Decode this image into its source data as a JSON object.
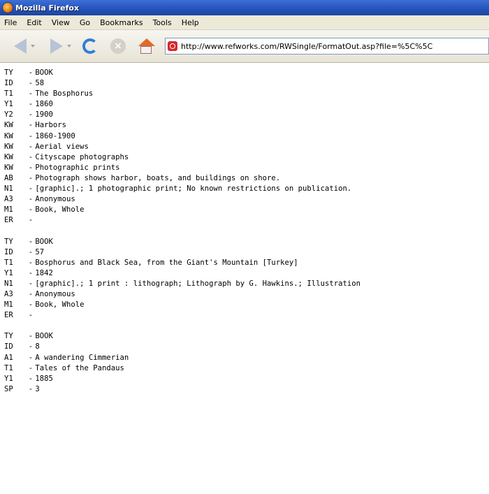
{
  "window": {
    "title": "Mozilla Firefox"
  },
  "menu": [
    "File",
    "Edit",
    "View",
    "Go",
    "Bookmarks",
    "Tools",
    "Help"
  ],
  "nav": {
    "url": "http://www.refworks.com/RWSingle/FormatOut.asp?file=%5C%5C"
  },
  "records": [
    [
      {
        "tag": "TY",
        "value": "BOOK"
      },
      {
        "tag": "ID",
        "value": "58"
      },
      {
        "tag": "T1",
        "value": "The Bosphorus"
      },
      {
        "tag": "Y1",
        "value": "1860"
      },
      {
        "tag": "Y2",
        "value": "1900"
      },
      {
        "tag": "KW",
        "value": "Harbors"
      },
      {
        "tag": "KW",
        "value": "1860-1900"
      },
      {
        "tag": "KW",
        "value": "Aerial views"
      },
      {
        "tag": "KW",
        "value": "Cityscape photographs"
      },
      {
        "tag": "KW",
        "value": "Photographic prints"
      },
      {
        "tag": "AB",
        "value": "Photograph shows harbor, boats, and buildings on shore."
      },
      {
        "tag": "N1",
        "value": "[graphic].; 1 photographic print; No known restrictions on publication."
      },
      {
        "tag": "A3",
        "value": "Anonymous"
      },
      {
        "tag": "M1",
        "value": "Book, Whole"
      },
      {
        "tag": "ER",
        "value": ""
      }
    ],
    [
      {
        "tag": "TY",
        "value": "BOOK"
      },
      {
        "tag": "ID",
        "value": "57"
      },
      {
        "tag": "T1",
        "value": "Bosphorus and Black Sea, from the Giant's Mountain [Turkey]"
      },
      {
        "tag": "Y1",
        "value": "1842"
      },
      {
        "tag": "N1",
        "value": "[graphic].; 1 print : lithograph; Lithograph by G. Hawkins.; Illustration"
      },
      {
        "tag": "A3",
        "value": "Anonymous"
      },
      {
        "tag": "M1",
        "value": "Book, Whole"
      },
      {
        "tag": "ER",
        "value": ""
      }
    ],
    [
      {
        "tag": "TY",
        "value": "BOOK"
      },
      {
        "tag": "ID",
        "value": "8"
      },
      {
        "tag": "A1",
        "value": "A wandering Cimmerian"
      },
      {
        "tag": "T1",
        "value": "Tales of the Pandaus"
      },
      {
        "tag": "Y1",
        "value": "1885"
      },
      {
        "tag": "SP",
        "value": "3"
      }
    ]
  ]
}
